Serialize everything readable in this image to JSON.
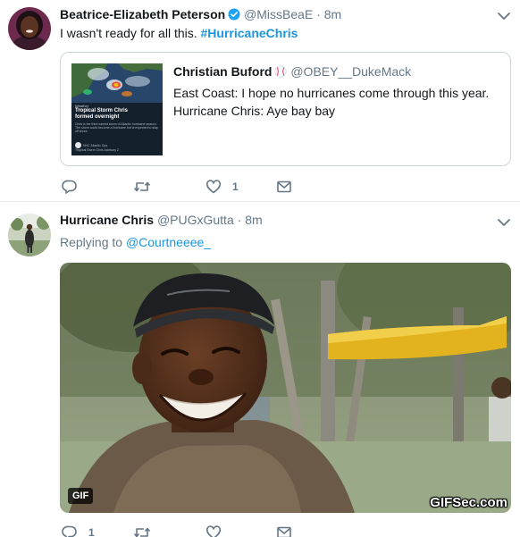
{
  "tweets": [
    {
      "author": {
        "name": "Beatrice-Elizabeth Peterson",
        "handle": "@MissBeaE",
        "verified": true
      },
      "separator": "·",
      "time": "8m",
      "text_prefix": "I wasn't ready for all this. ",
      "hashtag": "#HurricaneChris",
      "quoted": {
        "author_name": "Christian Buford",
        "author_emoji": "baseball-emoji",
        "handle": "@OBEY__DukeMack",
        "line1": "East Coast: I hope no hurricanes come through this year.",
        "line2": "Hurricane Chris: Aye bay bay",
        "thumbnail": {
          "small_label": "Weather",
          "title_line1": "Tropical Storm Chris",
          "title_line2": "formed overnight",
          "body": "Chris is the third named storm of Atlantic hurricane season. The storm could become a hurricane but is expected to stay off shore.",
          "footer_source": "NHC Atlantic Ops",
          "footer_text": "Tropical Storm Chris Advisory 2"
        }
      },
      "actions": {
        "reply_count": "",
        "retweet_count": "",
        "like_count": "1"
      }
    },
    {
      "author": {
        "name": "Hurricane Chris",
        "handle": "@PUGxGutta",
        "verified": false
      },
      "separator": "·",
      "time": "8m",
      "replying_label": "Replying to",
      "replying_to": "@Courtneeee_",
      "media": {
        "badge": "GIF",
        "watermark": "GIFSec.com"
      },
      "actions": {
        "reply_count": "1",
        "retweet_count": "",
        "like_count": ""
      }
    }
  ],
  "colors": {
    "link": "#1b95e0",
    "secondary_text": "#657786",
    "primary_text": "#14171a",
    "border": "#e6ecf0"
  }
}
